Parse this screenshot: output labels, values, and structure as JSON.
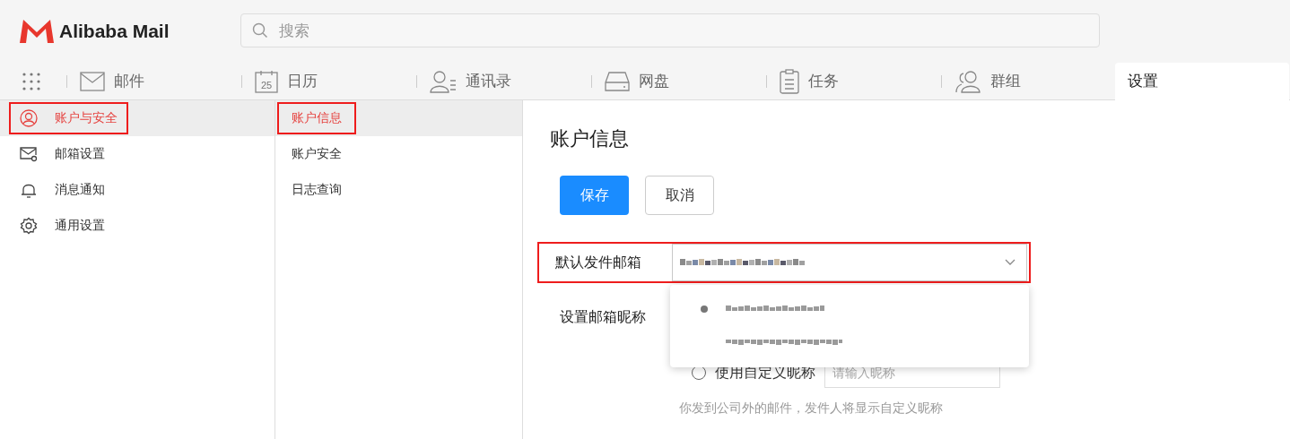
{
  "header": {
    "logo_text": "Alibaba Mail",
    "search": {
      "placeholder": "搜索"
    }
  },
  "tabs": [
    {
      "label": "邮件",
      "selected": false
    },
    {
      "label": "日历",
      "icon_text": "25",
      "selected": false
    },
    {
      "label": "通讯录",
      "selected": false
    },
    {
      "label": "网盘",
      "selected": false
    },
    {
      "label": "任务",
      "selected": false
    },
    {
      "label": "群组",
      "selected": false
    },
    {
      "label": "设置",
      "selected": true
    }
  ],
  "sidebar": {
    "items": [
      {
        "label": "账户与安全",
        "selected": true,
        "annotated": true
      },
      {
        "label": "邮箱设置",
        "selected": false,
        "annotated": false
      },
      {
        "label": "消息通知",
        "selected": false,
        "annotated": false
      },
      {
        "label": "通用设置",
        "selected": false,
        "annotated": false
      }
    ]
  },
  "subnav": {
    "items": [
      {
        "label": "账户信息",
        "selected": true,
        "annotated": true
      },
      {
        "label": "账户安全",
        "selected": false,
        "annotated": false
      },
      {
        "label": "日志查询",
        "selected": false,
        "annotated": false
      }
    ]
  },
  "content": {
    "title": "账户信息",
    "buttons": [
      {
        "label": "保存",
        "kind": "primary"
      },
      {
        "label": "取消",
        "kind": "default"
      }
    ],
    "default_sender": {
      "label": "默认发件邮箱",
      "annotated": true,
      "expanded": true,
      "options": [
        {
          "selected": true
        },
        {
          "selected": false
        }
      ]
    },
    "nickname": {
      "label": "设置邮箱昵称",
      "custom_option": {
        "label": "使用自定义昵称",
        "selected": false
      },
      "input": {
        "placeholder": "请输入昵称"
      },
      "hint": "你发到公司外的邮件，发件人将显示自定义昵称"
    }
  }
}
